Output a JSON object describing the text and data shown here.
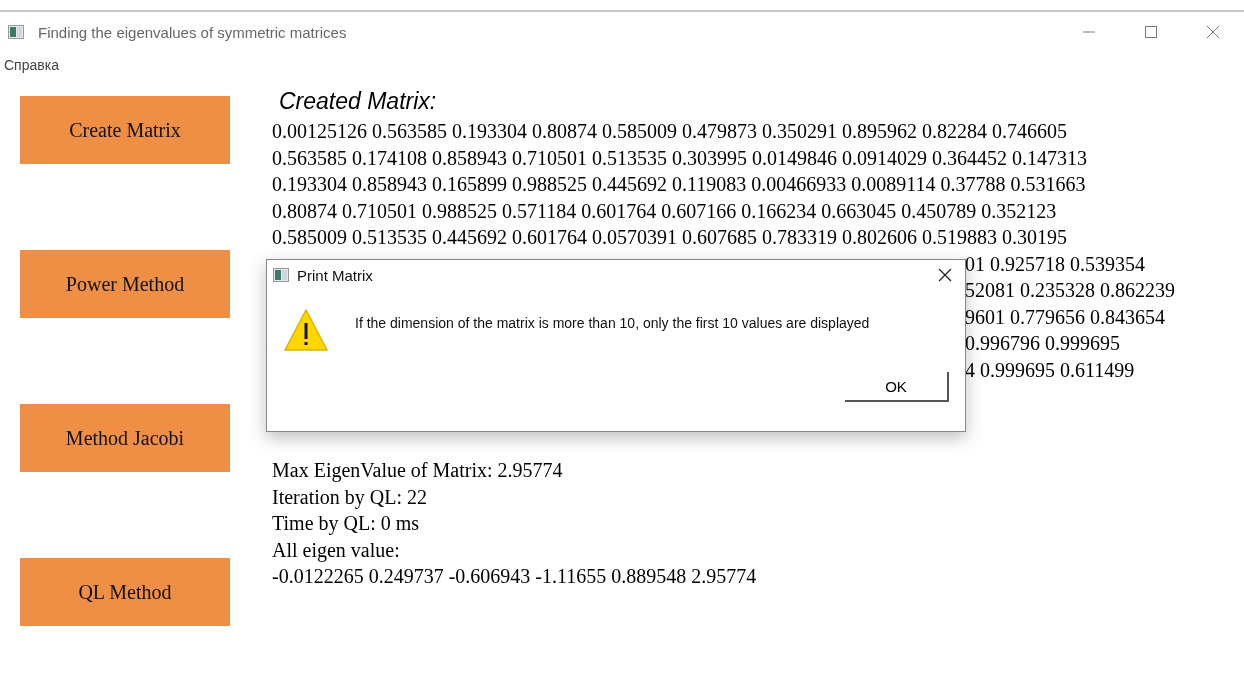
{
  "window": {
    "title": "Finding the eigenvalues of symmetric matrices"
  },
  "menu": [
    "Справка"
  ],
  "buttons": [
    "Create Matrix",
    "Power Method",
    "Method Jacobi",
    "QL Method"
  ],
  "matrix": {
    "heading": "Created Matrix:",
    "rows": [
      "0.00125126 0.563585 0.193304 0.80874 0.585009 0.479873 0.350291 0.895962 0.82284 0.746605",
      "0.563585 0.174108 0.858943 0.710501 0.513535 0.303995 0.0149846 0.0914029 0.364452 0.147313",
      "0.193304 0.858943 0.165899 0.988525 0.445692 0.119083 0.00466933 0.0089114 0.37788 0.531663",
      "0.80874 0.710501 0.988525 0.571184 0.601764 0.607166 0.166234 0.663045 0.450789 0.352123",
      "0.585009 0.513535 0.445692 0.601764 0.0570391 0.607685 0.783319 0.802606 0.519883 0.30195",
      "01 0.925718 0.539354",
      "52081 0.235328 0.862239",
      "9601 0.779656 0.843654",
      "0.996796 0.999695",
      "4 0.999695 0.611499"
    ]
  },
  "results": {
    "lines": [
      "Max EigenValue of Matrix: 2.95774",
      "Iteration by QL: 22",
      "Time by QL: 0 ms",
      "All eigen value:",
      "-0.0122265 0.249737 -0.606943 -1.11655 0.889548 2.95774"
    ]
  },
  "dialog": {
    "title": "Print Matrix",
    "message": "If the dimension of the matrix is more than 10, only the first 10 values are displayed",
    "button": "OK"
  }
}
